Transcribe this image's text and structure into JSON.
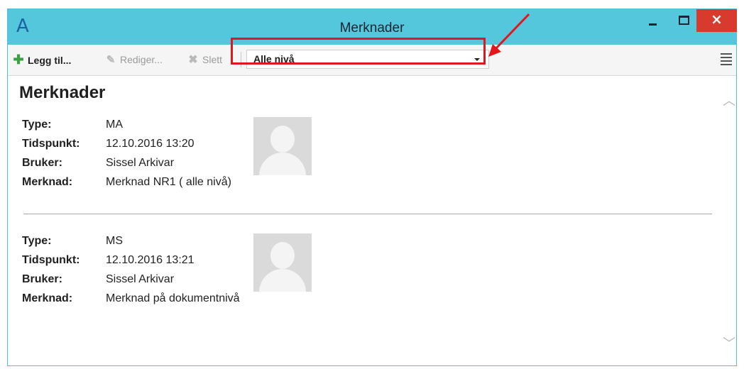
{
  "window": {
    "title": "Merknader",
    "logo": "A",
    "minimize_glyph": "–",
    "close_glyph": "×"
  },
  "toolbar": {
    "add_label": "Legg til...",
    "edit_label": "Rediger...",
    "delete_label": "Slett",
    "level_filter": {
      "selected": "Alle nivå"
    }
  },
  "content": {
    "heading": "Merknader",
    "labels": {
      "type": "Type:",
      "time": "Tidspunkt:",
      "user": "Bruker:",
      "note": "Merknad:"
    },
    "entries": [
      {
        "type": "MA",
        "time": "12.10.2016 13:20",
        "user": "Sissel Arkivar",
        "note": "Merknad NR1  ( alle nivå)"
      },
      {
        "type": "MS",
        "time": "12.10.2016 13:21",
        "user": "Sissel Arkivar",
        "note": "Merknad på dokumentnivå"
      }
    ]
  },
  "colors": {
    "titlebar": "#55c7dd",
    "close_button": "#d83b2e",
    "annotation": "#e3161c",
    "add_icon": "#3ea044"
  },
  "icons": [
    "app-logo",
    "plus-icon",
    "pencil-icon",
    "delete-x-icon",
    "chevron-down-icon",
    "list-view-icon",
    "scroll-up-icon",
    "scroll-down-icon",
    "avatar-placeholder"
  ]
}
